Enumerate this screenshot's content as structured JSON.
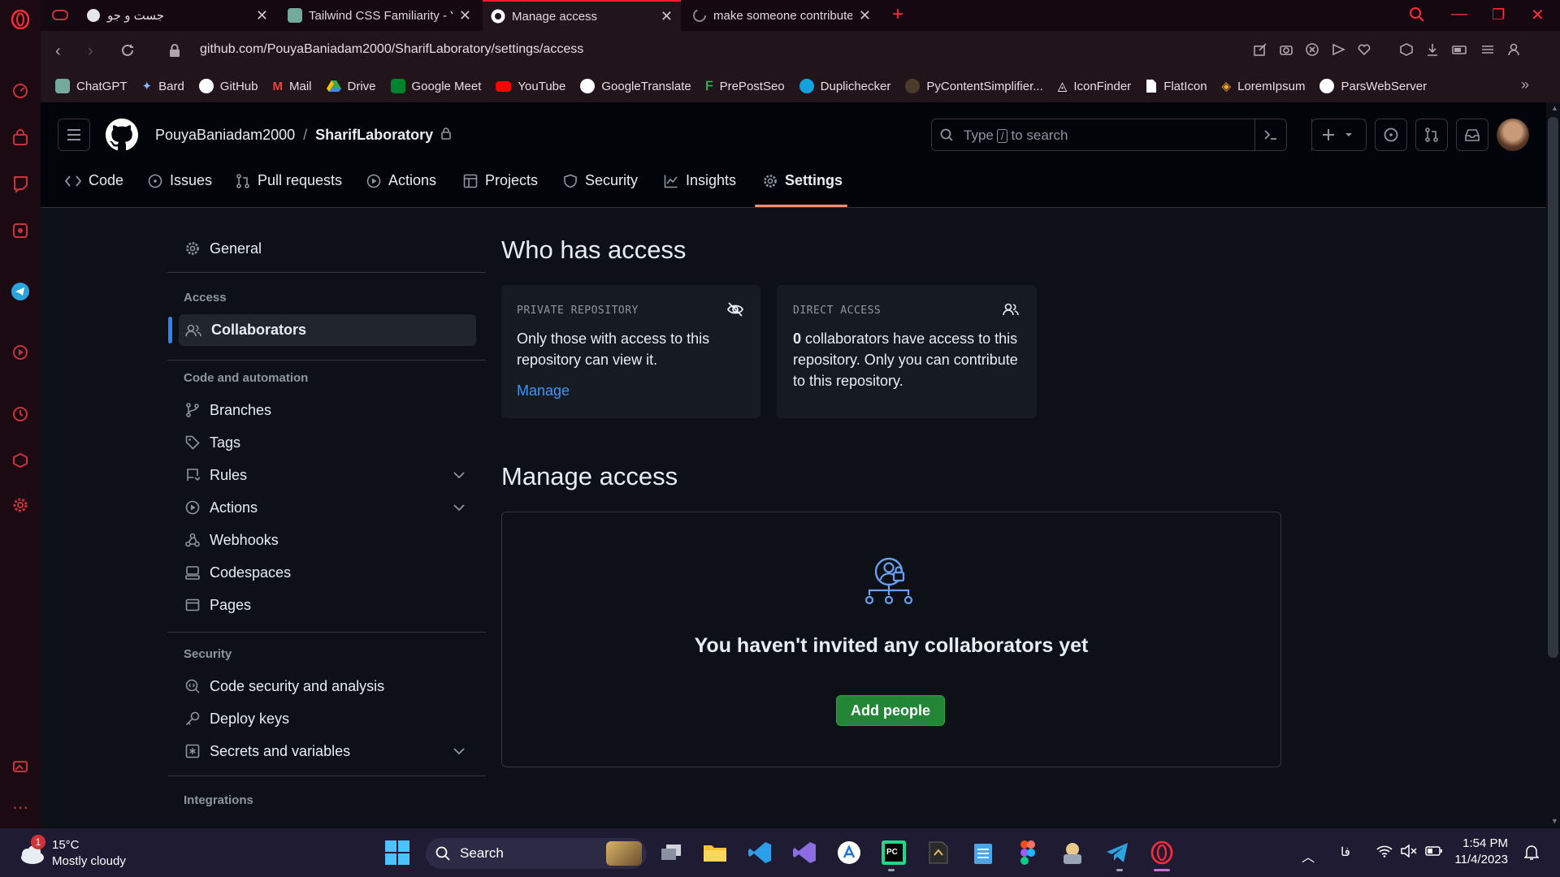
{
  "browser": {
    "tabs": [
      {
        "label": "جست و جو",
        "active": false
      },
      {
        "label": "Tailwind CSS Familiarity - Yo",
        "active": false
      },
      {
        "label": "Manage access",
        "active": true
      },
      {
        "label": "make someone contributer",
        "active": false
      }
    ],
    "url": "github.com/PouyaBaniadam2000/SharifLaboratory/settings/access",
    "bookmarks": [
      "ChatGPT",
      "Bard",
      "GitHub",
      "Mail",
      "Drive",
      "Google Meet",
      "YouTube",
      "GoogleTranslate",
      "PrePostSeo",
      "Duplichecker",
      "PyContentSimplifier...",
      "IconFinder",
      "FlatIcon",
      "LoremIpsum",
      "ParsWebServer"
    ]
  },
  "repo": {
    "owner": "PouyaBaniadam2000",
    "separator": "/",
    "name": "SharifLaboratory",
    "search_placeholder_pre": "Type",
    "search_key": "/",
    "search_placeholder_post": "to search"
  },
  "nav": {
    "code": "Code",
    "issues": "Issues",
    "pulls": "Pull requests",
    "actions": "Actions",
    "projects": "Projects",
    "security": "Security",
    "insights": "Insights",
    "settings": "Settings"
  },
  "sidebar": {
    "general": "General",
    "access_head": "Access",
    "collaborators": "Collaborators",
    "code_head": "Code and automation",
    "branches": "Branches",
    "tags": "Tags",
    "rules": "Rules",
    "actions": "Actions",
    "webhooks": "Webhooks",
    "codespaces": "Codespaces",
    "pages": "Pages",
    "security_head": "Security",
    "code_security": "Code security and analysis",
    "deploy_keys": "Deploy keys",
    "secrets": "Secrets and variables",
    "integrations_head": "Integrations"
  },
  "main": {
    "who_title": "Who has access",
    "private_label": "PRIVATE REPOSITORY",
    "private_text": "Only those with access to this repository can view it.",
    "manage_link": "Manage",
    "direct_label": "DIRECT ACCESS",
    "direct_count": "0",
    "direct_text": " collaborators have access to this repository. Only you can contribute to this repository.",
    "manage_title": "Manage access",
    "empty_title": "You haven't invited any collaborators yet",
    "add_button": "Add people"
  },
  "taskbar": {
    "weather_badge": "1",
    "weather_temp": "15°C",
    "weather_desc": "Mostly cloudy",
    "search": "Search",
    "lang": "فا",
    "time": "1:54 PM",
    "date": "11/4/2023"
  },
  "colors": {
    "accent": "#2f81f7",
    "add_button": "#238636",
    "underline": "#fd8c73",
    "opera_red": "#ff1b2d"
  }
}
